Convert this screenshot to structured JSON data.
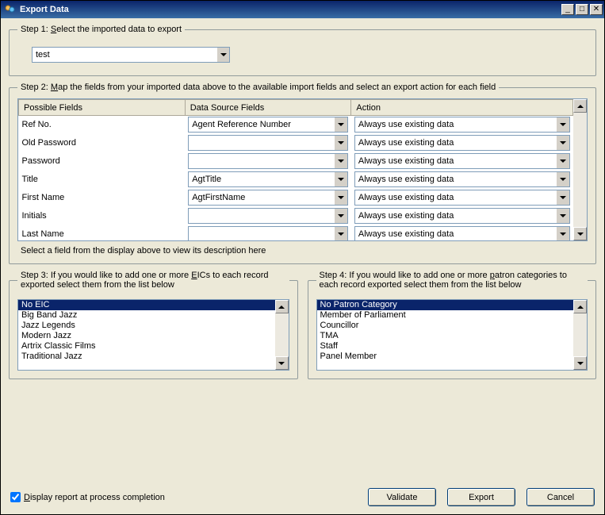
{
  "window": {
    "title": "Export Data"
  },
  "step1": {
    "legend_prefix": "Step 1: ",
    "legend_u": "S",
    "legend_rest": "elect the imported data to export",
    "selected": "test"
  },
  "step2": {
    "legend_prefix": "Step 2: ",
    "legend_u": "M",
    "legend_rest": "ap the fields from your imported data above to the available import fields and select an export action for each field",
    "headers": {
      "col1": "Possible Fields",
      "col2": "Data Source Fields",
      "col3": "Action"
    },
    "rows": [
      {
        "field": "Ref No.",
        "source": "Agent Reference Number",
        "action": "Always use existing data"
      },
      {
        "field": "Old Password",
        "source": "",
        "action": "Always use existing data"
      },
      {
        "field": "Password",
        "source": "",
        "action": "Always use existing data"
      },
      {
        "field": "Title",
        "source": "AgtTitle",
        "action": "Always use existing data"
      },
      {
        "field": "First Name",
        "source": "AgtFirstName",
        "action": "Always use existing data"
      },
      {
        "field": "Initials",
        "source": "",
        "action": "Always use existing data"
      },
      {
        "field": "Last Name",
        "source": "",
        "action": "Always use existing data"
      }
    ],
    "description": "Select a field from the display above to view its description here"
  },
  "step3": {
    "legend_prefix": "Step 3: If you would like to add one or more ",
    "legend_u": "E",
    "legend_rest": "ICs to each record exported select them from the list below",
    "items": [
      "No EIC",
      "Big Band Jazz",
      "Jazz Legends",
      "Modern Jazz",
      "Artrix Classic Films",
      "Traditional Jazz"
    ],
    "selected_index": 0
  },
  "step4": {
    "legend_prefix": "Step 4: If you would like to add one or more ",
    "legend_u": "p",
    "legend_rest": "atron categories to each record exported select them from the list below",
    "items": [
      "No Patron Category",
      "Member of Parliament",
      "Councillor",
      "TMA",
      "Staff",
      "Panel Member"
    ],
    "selected_index": 0
  },
  "bottom": {
    "checkbox_prefix": "",
    "checkbox_u": "D",
    "checkbox_rest": "isplay report at process completion",
    "checked": true,
    "validate": "Validate",
    "export": "Export",
    "cancel": "Cancel"
  }
}
